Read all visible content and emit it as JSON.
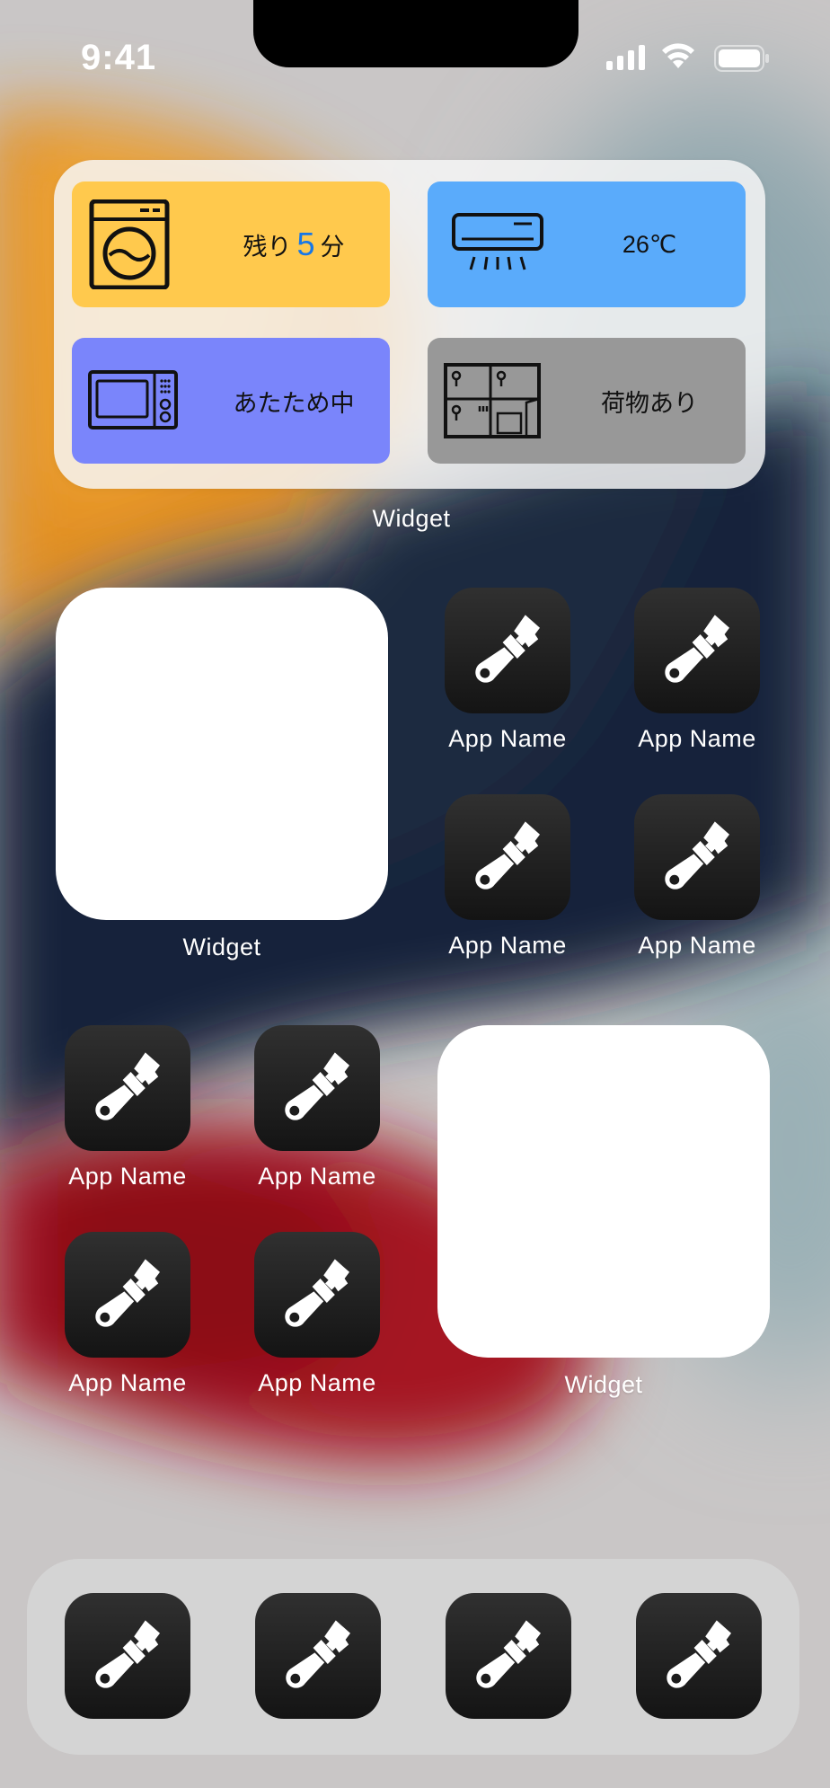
{
  "status_bar": {
    "time": "9:41"
  },
  "smart_widget": {
    "washer": {
      "prefix": "残り",
      "value": "5",
      "suffix": "分",
      "color": "#ffc94d",
      "icon": "washing-machine-icon"
    },
    "aircon": {
      "label": "26℃",
      "color": "#5aabfb",
      "icon": "air-conditioner-icon"
    },
    "microwave": {
      "label": "あたため中",
      "color": "#7a85fb",
      "icon": "microwave-icon"
    },
    "locker": {
      "label": "荷物あり",
      "color": "#989898",
      "icon": "parcel-locker-icon"
    },
    "caption": "Widget"
  },
  "widget_left": {
    "caption": "Widget"
  },
  "widget_right": {
    "caption": "Widget"
  },
  "apps": [
    {
      "name": "App Name",
      "icon": "paintbrush-icon"
    },
    {
      "name": "App Name",
      "icon": "paintbrush-icon"
    },
    {
      "name": "App Name",
      "icon": "paintbrush-icon"
    },
    {
      "name": "App Name",
      "icon": "paintbrush-icon"
    },
    {
      "name": "App Name",
      "icon": "paintbrush-icon"
    },
    {
      "name": "App Name",
      "icon": "paintbrush-icon"
    },
    {
      "name": "App Name",
      "icon": "paintbrush-icon"
    },
    {
      "name": "App Name",
      "icon": "paintbrush-icon"
    }
  ],
  "dock": [
    {
      "icon": "paintbrush-icon"
    },
    {
      "icon": "paintbrush-icon"
    },
    {
      "icon": "paintbrush-icon"
    },
    {
      "icon": "paintbrush-icon"
    }
  ],
  "colors": {
    "accent_number": "#1677e8",
    "icon_bg": "#1c1c1c"
  }
}
